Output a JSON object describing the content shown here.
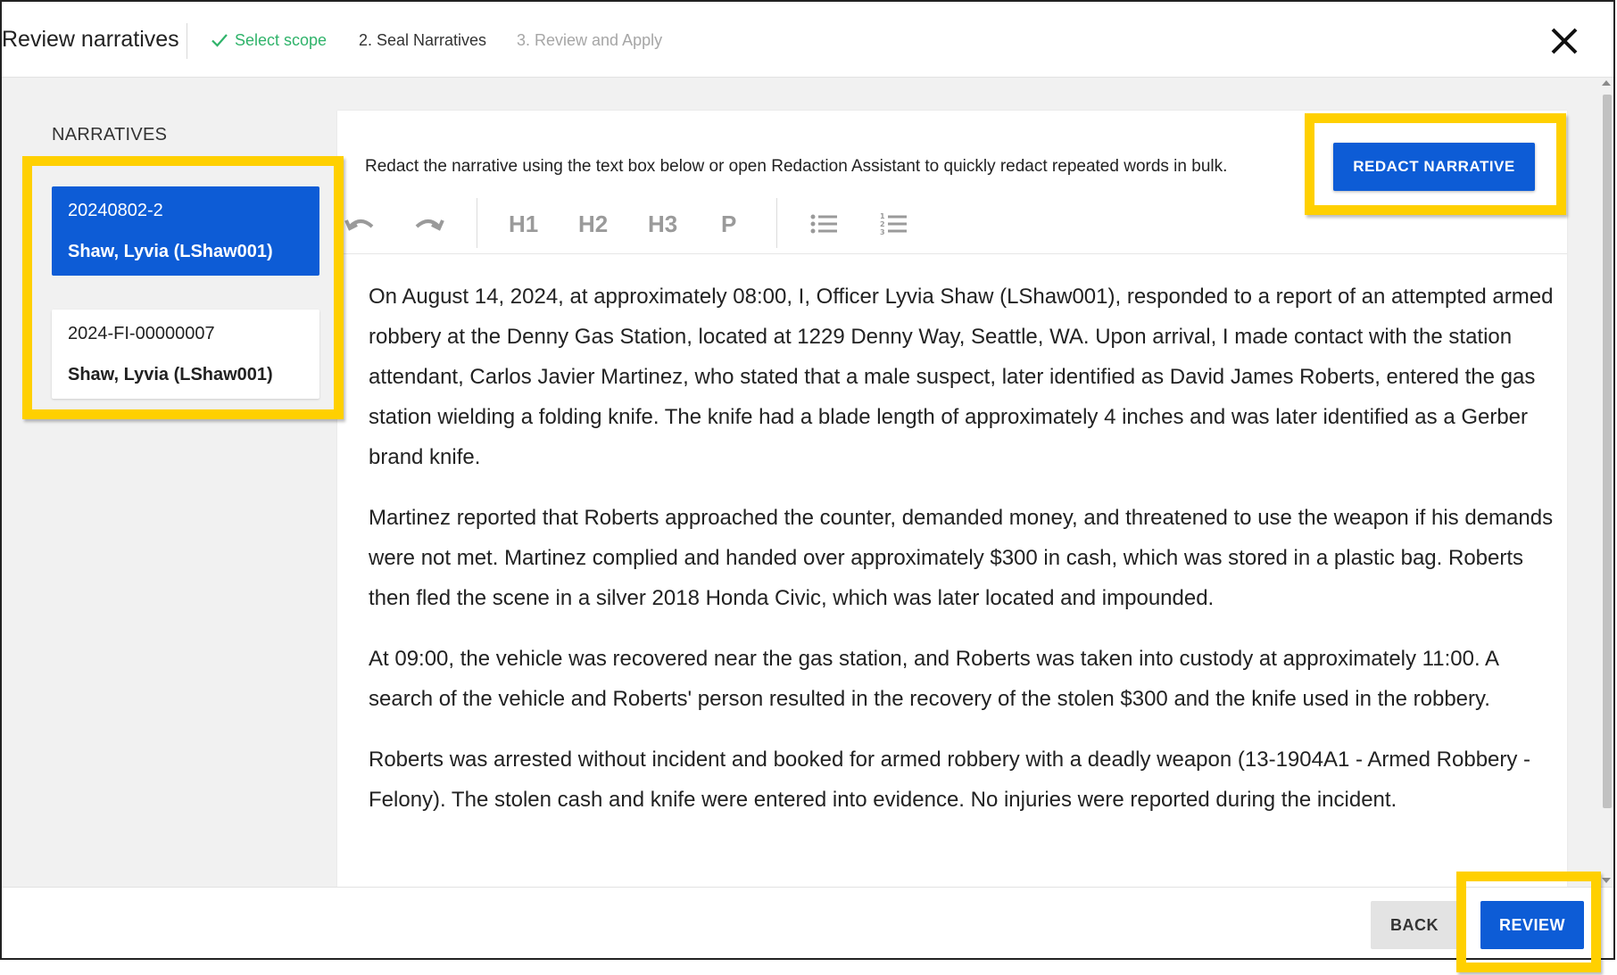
{
  "header": {
    "title": "Review narratives",
    "steps": [
      {
        "label": "Select scope",
        "state": "complete"
      },
      {
        "label": "2. Seal Narratives",
        "state": "active"
      },
      {
        "label": "3. Review and Apply",
        "state": "upcoming"
      }
    ],
    "close_icon": "close-icon"
  },
  "sidebar": {
    "title": "NARRATIVES",
    "items": [
      {
        "id": "20240802-2",
        "author": "Shaw, Lyvia (LShaw001)",
        "selected": true
      },
      {
        "id": "2024-FI-00000007",
        "author": "Shaw, Lyvia (LShaw001)",
        "selected": false
      }
    ]
  },
  "editor": {
    "instruction": "Redact the narrative using the text box below or open Redaction Assistant to quickly redact repeated words in bulk.",
    "redact_button": "REDACT NARRATIVE",
    "toolbar": {
      "undo_icon": "undo-icon",
      "redo_icon": "redo-icon",
      "h1": "H1",
      "h2": "H2",
      "h3": "H3",
      "p": "P",
      "bullet_icon": "bulleted-list-icon",
      "numbered_icon": "numbered-list-icon"
    },
    "paragraphs": [
      "On August 14, 2024, at approximately 08:00, I, Officer Lyvia Shaw (LShaw001), responded to a report of an attempted armed robbery at the Denny Gas Station, located at 1229 Denny Way, Seattle, WA. Upon arrival, I made contact with the station attendant, Carlos Javier Martinez, who stated that a male suspect, later identified as David James Roberts, entered the gas station wielding a folding knife. The knife had a blade length of approximately 4 inches and was later identified as a Gerber brand knife.",
      "Martinez reported that Roberts approached the counter, demanded money, and threatened to use the weapon if his demands were not met. Martinez complied and handed over approximately $300 in cash, which was stored in a plastic bag. Roberts then fled the scene in a silver 2018 Honda Civic, which was later located and impounded.",
      "At 09:00, the vehicle was recovered near the gas station, and Roberts was taken into custody at approximately 11:00. A search of the vehicle and Roberts' person resulted in the recovery of the stolen $300 and the knife used in the robbery.",
      "Roberts was arrested without incident and booked for armed robbery with a deadly weapon (13-1904A1 - Armed Robbery - Felony). The stolen cash and knife were entered into evidence. No injuries were reported during the incident."
    ]
  },
  "footer": {
    "back_label": "BACK",
    "review_label": "REVIEW"
  },
  "colors": {
    "accent": "#0d5cd6",
    "success": "#2fb36a",
    "highlight": "#ffd000"
  }
}
